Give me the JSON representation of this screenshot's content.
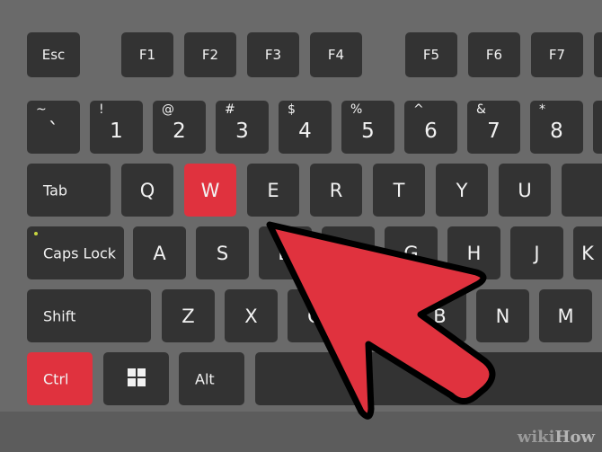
{
  "colors": {
    "background": "#6a6a6a",
    "key": "#333333",
    "highlight": "#e0323e",
    "arrow": "#e0323e"
  },
  "rows": [
    {
      "keys": [
        {
          "label": "Esc",
          "type": "fn"
        },
        {
          "label": "F1",
          "type": "fn"
        },
        {
          "label": "F2",
          "type": "fn"
        },
        {
          "label": "F3",
          "type": "fn"
        },
        {
          "label": "F4",
          "type": "fn"
        },
        {
          "label": "F5",
          "type": "fn"
        },
        {
          "label": "F6",
          "type": "fn"
        },
        {
          "label": "F7",
          "type": "fn"
        },
        {
          "label": "",
          "type": "fn"
        }
      ]
    },
    {
      "keys": [
        {
          "label": "`",
          "shift": "~",
          "type": "num"
        },
        {
          "label": "1",
          "shift": "!",
          "type": "num"
        },
        {
          "label": "2",
          "shift": "@",
          "type": "num"
        },
        {
          "label": "3",
          "shift": "#",
          "type": "num"
        },
        {
          "label": "4",
          "shift": "$",
          "type": "num"
        },
        {
          "label": "5",
          "shift": "%",
          "type": "num"
        },
        {
          "label": "6",
          "shift": "^",
          "type": "num"
        },
        {
          "label": "7",
          "shift": "&",
          "type": "num"
        },
        {
          "label": "8",
          "shift": "*",
          "type": "num"
        },
        {
          "label": "",
          "type": "num"
        }
      ]
    },
    {
      "keys": [
        {
          "label": "Tab",
          "type": "wide"
        },
        {
          "label": "Q"
        },
        {
          "label": "W",
          "highlighted": true
        },
        {
          "label": "E"
        },
        {
          "label": "R"
        },
        {
          "label": "T"
        },
        {
          "label": "Y"
        },
        {
          "label": "U"
        },
        {
          "label": ""
        }
      ]
    },
    {
      "keys": [
        {
          "label": "Caps Lock",
          "type": "wide",
          "led": true
        },
        {
          "label": "A"
        },
        {
          "label": "S"
        },
        {
          "label": "D"
        },
        {
          "label": "F"
        },
        {
          "label": "G"
        },
        {
          "label": "H"
        },
        {
          "label": "J"
        },
        {
          "label": "K"
        }
      ]
    },
    {
      "keys": [
        {
          "label": "Shift",
          "type": "wide"
        },
        {
          "label": "Z"
        },
        {
          "label": "X"
        },
        {
          "label": "C"
        },
        {
          "label": "V"
        },
        {
          "label": "B"
        },
        {
          "label": "N"
        },
        {
          "label": "M"
        }
      ]
    },
    {
      "keys": [
        {
          "label": "Ctrl",
          "type": "wide",
          "highlighted": true
        },
        {
          "label": "",
          "icon": "windows-icon"
        },
        {
          "label": "Alt",
          "type": "wide"
        },
        {
          "label": "",
          "type": "space"
        }
      ]
    }
  ],
  "logo": {
    "text_a": "wiki",
    "text_b": "How"
  }
}
